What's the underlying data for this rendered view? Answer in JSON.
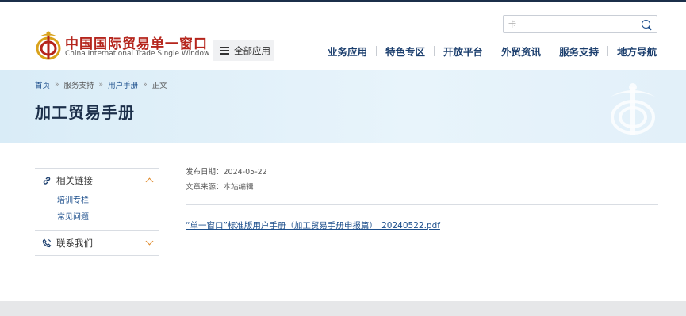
{
  "header": {
    "logo_cn": "中国国际贸易单一窗口",
    "logo_en": "China International Trade Single Window",
    "all_apps_label": "全部应用",
    "search": {
      "placeholder": "卡",
      "value": ""
    },
    "nav": [
      "业务应用",
      "特色专区",
      "开放平台",
      "外贸资讯",
      "服务支持",
      "地方导航"
    ]
  },
  "banner": {
    "breadcrumb": [
      "首页",
      "服务支持",
      "用户手册",
      "正文"
    ],
    "breadcrumb_sep": "»",
    "title": "加工贸易手册"
  },
  "sidebar": {
    "sections": [
      {
        "label": "相关链接",
        "expanded": true,
        "items": [
          "培训专栏",
          "常见问题"
        ]
      },
      {
        "label": "联系我们",
        "expanded": false,
        "items": []
      }
    ]
  },
  "article": {
    "publish_date": "发布日期：2024-05-22",
    "source": "文章来源：本站编辑",
    "attachment": "“单一窗口”标准版用户手册（加工贸易手册申报篇）_20240522.pdf"
  },
  "colors": {
    "brand_red": "#b5251c",
    "nav_blue": "#1c3f6e",
    "link_blue": "#1d4f8c",
    "accent_orange": "#e08a2b"
  }
}
